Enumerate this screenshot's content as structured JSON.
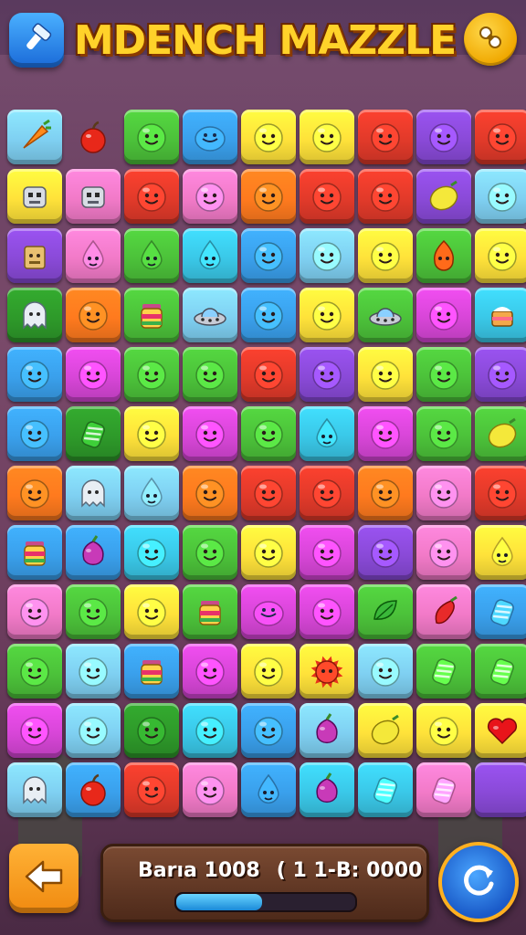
{
  "header": {
    "title": "MDENCH MAZZLE",
    "left_button_icon": "hammer-icon",
    "right_button_icon": "settings-icon"
  },
  "colors": {
    "blue": "#3aa0ec",
    "lightblue": "#7fd0f2",
    "yellow": "#ffe23a",
    "red": "#e23a2a",
    "orange": "#ff7a1e",
    "green": "#4cc23a",
    "pink": "#f27ac8",
    "purple": "#8a4ad8",
    "magenta": "#d846d8",
    "darkgreen": "#2e9a2a",
    "peach": "#ffb68a",
    "cyan": "#3ac8e8",
    "lime": "#9ee04a"
  },
  "board": {
    "rows": 12,
    "cols": 9,
    "tiles": [
      [
        [
          "lightblue",
          "carrot"
        ],
        [
          "empty",
          "apple"
        ],
        [
          "green",
          "face"
        ],
        [
          "blue",
          "blob"
        ],
        [
          "yellow",
          "face"
        ],
        [
          "yellow",
          "face"
        ],
        [
          "red",
          "face"
        ],
        [
          "purple",
          "face"
        ],
        [
          "red",
          "face"
        ]
      ],
      [
        [
          "yellow",
          "robot"
        ],
        [
          "pink",
          "robot"
        ],
        [
          "red",
          "face"
        ],
        [
          "pink",
          "face"
        ],
        [
          "orange",
          "face"
        ],
        [
          "red",
          "face"
        ],
        [
          "red",
          "face"
        ],
        [
          "purple",
          "lemon"
        ],
        [
          "lightblue",
          "face"
        ]
      ],
      [
        [
          "purple",
          "box"
        ],
        [
          "pink",
          "drop"
        ],
        [
          "green",
          "drop"
        ],
        [
          "cyan",
          "drop"
        ],
        [
          "blue",
          "face"
        ],
        [
          "lightblue",
          "face"
        ],
        [
          "yellow",
          "face"
        ],
        [
          "green",
          "flame"
        ],
        [
          "yellow",
          "face"
        ]
      ],
      [
        [
          "darkgreen",
          "ghost"
        ],
        [
          "orange",
          "face"
        ],
        [
          "green",
          "jar"
        ],
        [
          "lightblue",
          "ufo"
        ],
        [
          "blue",
          "face"
        ],
        [
          "yellow",
          "face"
        ],
        [
          "green",
          "ufo"
        ],
        [
          "magenta",
          "face"
        ],
        [
          "cyan",
          "cake"
        ]
      ],
      [
        [
          "blue",
          "face"
        ],
        [
          "magenta",
          "face"
        ],
        [
          "green",
          "face"
        ],
        [
          "green",
          "face"
        ],
        [
          "red",
          "face"
        ],
        [
          "purple",
          "face"
        ],
        [
          "yellow",
          "face"
        ],
        [
          "green",
          "face"
        ],
        [
          "purple",
          "face"
        ]
      ],
      [
        [
          "blue",
          "face"
        ],
        [
          "darkgreen",
          "candy"
        ],
        [
          "yellow",
          "face"
        ],
        [
          "magenta",
          "face"
        ],
        [
          "green",
          "face"
        ],
        [
          "cyan",
          "drop"
        ],
        [
          "magenta",
          "face"
        ],
        [
          "green",
          "face"
        ],
        [
          "green",
          "lemon"
        ]
      ],
      [
        [
          "orange",
          "face"
        ],
        [
          "lightblue",
          "ghost"
        ],
        [
          "lightblue",
          "drop"
        ],
        [
          "orange",
          "face"
        ],
        [
          "red",
          "face"
        ],
        [
          "red",
          "face"
        ],
        [
          "orange",
          "face"
        ],
        [
          "pink",
          "face"
        ],
        [
          "red",
          "face"
        ]
      ],
      [
        [
          "blue",
          "jar"
        ],
        [
          "blue",
          "plum"
        ],
        [
          "cyan",
          "face"
        ],
        [
          "green",
          "face"
        ],
        [
          "yellow",
          "face"
        ],
        [
          "magenta",
          "face"
        ],
        [
          "purple",
          "face"
        ],
        [
          "pink",
          "face"
        ],
        [
          "yellow",
          "drop"
        ]
      ],
      [
        [
          "pink",
          "face"
        ],
        [
          "green",
          "face"
        ],
        [
          "yellow",
          "face"
        ],
        [
          "green",
          "jar"
        ],
        [
          "magenta",
          "blob"
        ],
        [
          "magenta",
          "face"
        ],
        [
          "green",
          "leaf"
        ],
        [
          "pink",
          "pepper"
        ],
        [
          "blue",
          "candy"
        ]
      ],
      [
        [
          "green",
          "face"
        ],
        [
          "lightblue",
          "face"
        ],
        [
          "blue",
          "jar"
        ],
        [
          "magenta",
          "face"
        ],
        [
          "yellow",
          "face"
        ],
        [
          "yellow",
          "sun"
        ],
        [
          "lightblue",
          "face"
        ],
        [
          "green",
          "candy"
        ],
        [
          "green",
          "candy"
        ]
      ],
      [
        [
          "magenta",
          "face"
        ],
        [
          "lightblue",
          "face"
        ],
        [
          "darkgreen",
          "face"
        ],
        [
          "cyan",
          "face"
        ],
        [
          "blue",
          "face"
        ],
        [
          "lightblue",
          "plum"
        ],
        [
          "yellow",
          "lemon"
        ],
        [
          "yellow",
          "face"
        ],
        [
          "yellow",
          "heart"
        ]
      ],
      [
        [
          "lightblue",
          "ghost"
        ],
        [
          "blue",
          "apple"
        ],
        [
          "red",
          "face"
        ],
        [
          "pink",
          "face"
        ],
        [
          "blue",
          "drop"
        ],
        [
          "cyan",
          "plum"
        ],
        [
          "cyan",
          "candy"
        ],
        [
          "pink",
          "candy"
        ],
        [
          "purple",
          "empty"
        ]
      ]
    ]
  },
  "footer": {
    "back_icon": "arrow-left-icon",
    "status_left": "Barıa 1008",
    "status_right": "( 1 1-B: 0000",
    "progress": 0.48,
    "refresh_icon": "refresh-icon"
  }
}
